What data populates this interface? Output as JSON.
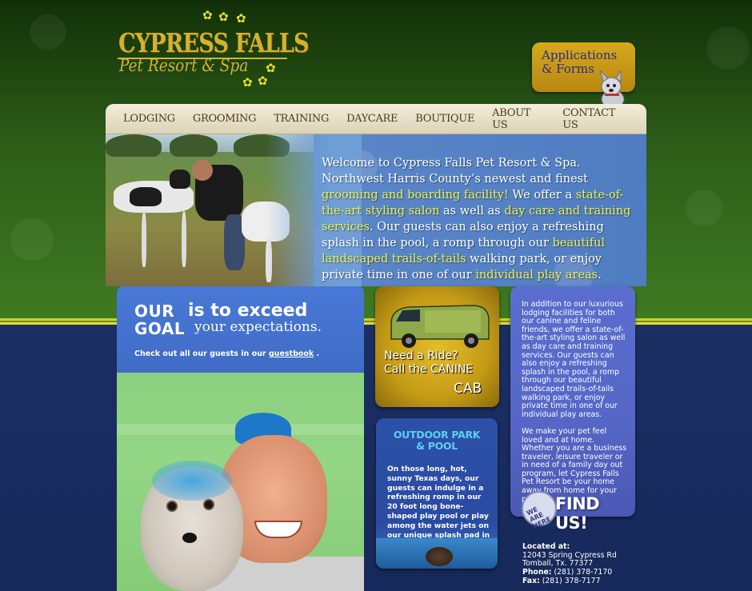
{
  "logo": {
    "title": "CYPRESS FALLS",
    "subtitle": "Pet Resort & Spa"
  },
  "applications": {
    "label_line1": "Applications",
    "label_line2": "& Forms"
  },
  "nav": {
    "items": [
      "LODGING",
      "GROOMING",
      "TRAINING",
      "DAYCARE",
      "BOUTIQUE",
      "ABOUT US",
      "CONTACT US"
    ]
  },
  "hero": {
    "t1": "Welcome to Cypress Falls Pet Resort & Spa. Northwest Harris County’s newest and finest ",
    "h1": "grooming and boarding facility!",
    "t2": " We offer a ",
    "h2": "state-of-the-art styling salon",
    "t3": " as well as ",
    "h3": "day care and training services",
    "t4": ". Our guests can also enjoy a refreshing splash in the pool, a romp through our ",
    "h4": "beautiful landscaped trails-of-tails",
    "t5": " walking park, or enjoy private time in one of our ",
    "h5": "individual play areas",
    "t6": "."
  },
  "goal": {
    "our": "OUR",
    "goal": "GOAL",
    "exceed": "is to exceed",
    "expectations": "your expectations.",
    "guest_prefix": "Check out all our guests in our ",
    "guest_link": "guestbook",
    "guest_suffix": " ."
  },
  "cab": {
    "line1": "Need a Ride?",
    "line2": "Call the CANINE",
    "line3": "CAB"
  },
  "park": {
    "title_line1": "OUTDOOR PARK",
    "title_line2": "& POOL",
    "text": "On those long, hot, sunny Texas days, our guests can indulge in a refreshing romp in our 20 foot long bone-shaped play pool or play among the water jets on our unique splash pad in our designated water park."
  },
  "info": {
    "para1": "In addition to our luxurious lodging facilities for both our canine and feline friends, we offer a state-of-the-art styling salon as well as day care and training services. Our guests can also enjoy a refreshing splash in the pool, a romp through our beautiful landscaped trails-of-tails walking park, or enjoy private time in one of our individual play areas.",
    "para2": "We make your pet feel loved and at home. Whether you are a business traveler, leisure traveler or in need of a family day out program, let Cypress Falls Pet Resort be your home away from home for your pet."
  },
  "find": {
    "badge": "WE ARE HERE",
    "label": "FIND US!"
  },
  "location": {
    "heading": "Located at:",
    "address1": "12043 Spring Cypress Rd",
    "address2": "Tomball, Tx. 77377",
    "phone_label": "Phone:",
    "phone": "(281) 378-7170",
    "fax_label": "Fax:",
    "fax": "(281) 378-7177"
  }
}
